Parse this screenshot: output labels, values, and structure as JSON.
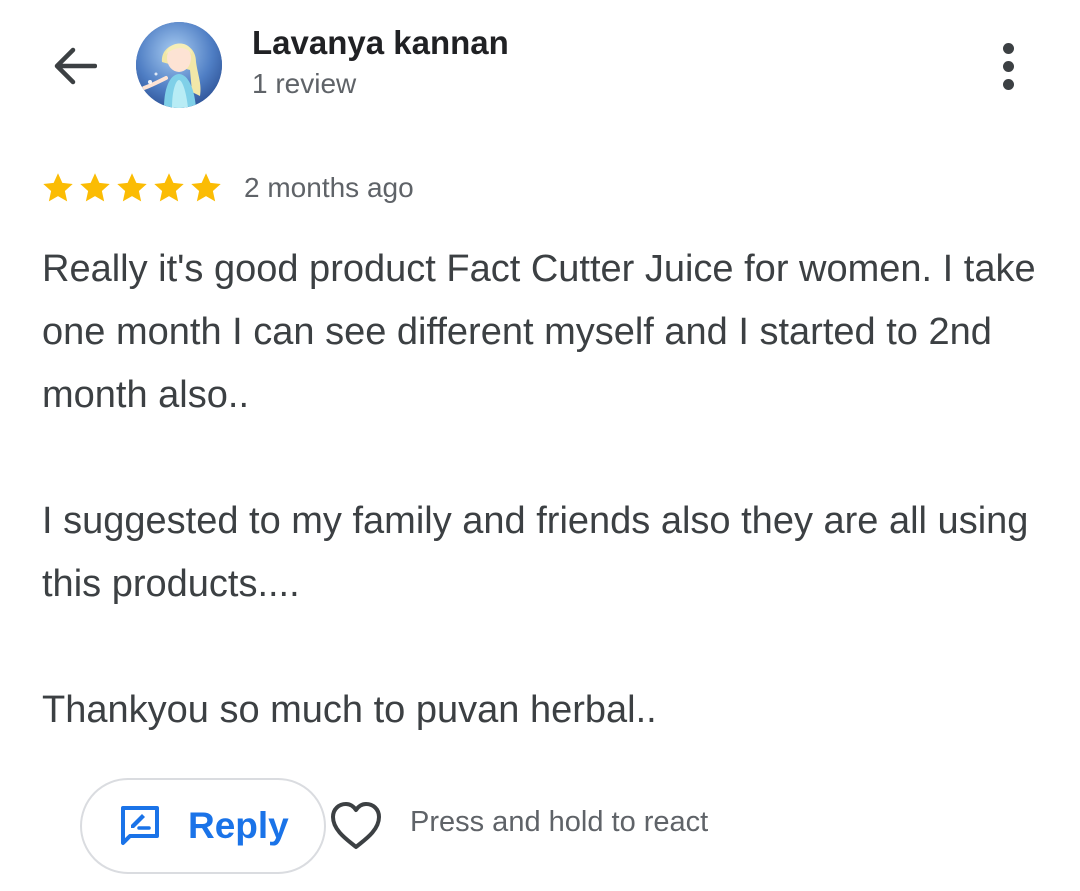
{
  "header": {
    "back_icon": "arrow-back-icon",
    "avatar_icon": "profile-avatar",
    "reviewer_name": "Lavanya kannan",
    "review_count": "1 review",
    "more_icon": "more-vertical-icon"
  },
  "review": {
    "rating": 5,
    "rating_max": 5,
    "star_color": "#fbbc04",
    "time_ago": "2 months ago",
    "paragraphs": [
      "Really it's good product Fact Cutter Juice for women. I take one month I can see different myself and I started to 2nd month also..",
      "I suggested to my family and friends also they are all using this products....",
      "Thankyou so much to puvan herbal.."
    ]
  },
  "actions": {
    "reply_icon": "reply-icon",
    "reply_label": "Reply",
    "heart_icon": "heart-outline-icon",
    "react_hint": "Press and hold to react",
    "accent_color": "#1a73e8"
  }
}
